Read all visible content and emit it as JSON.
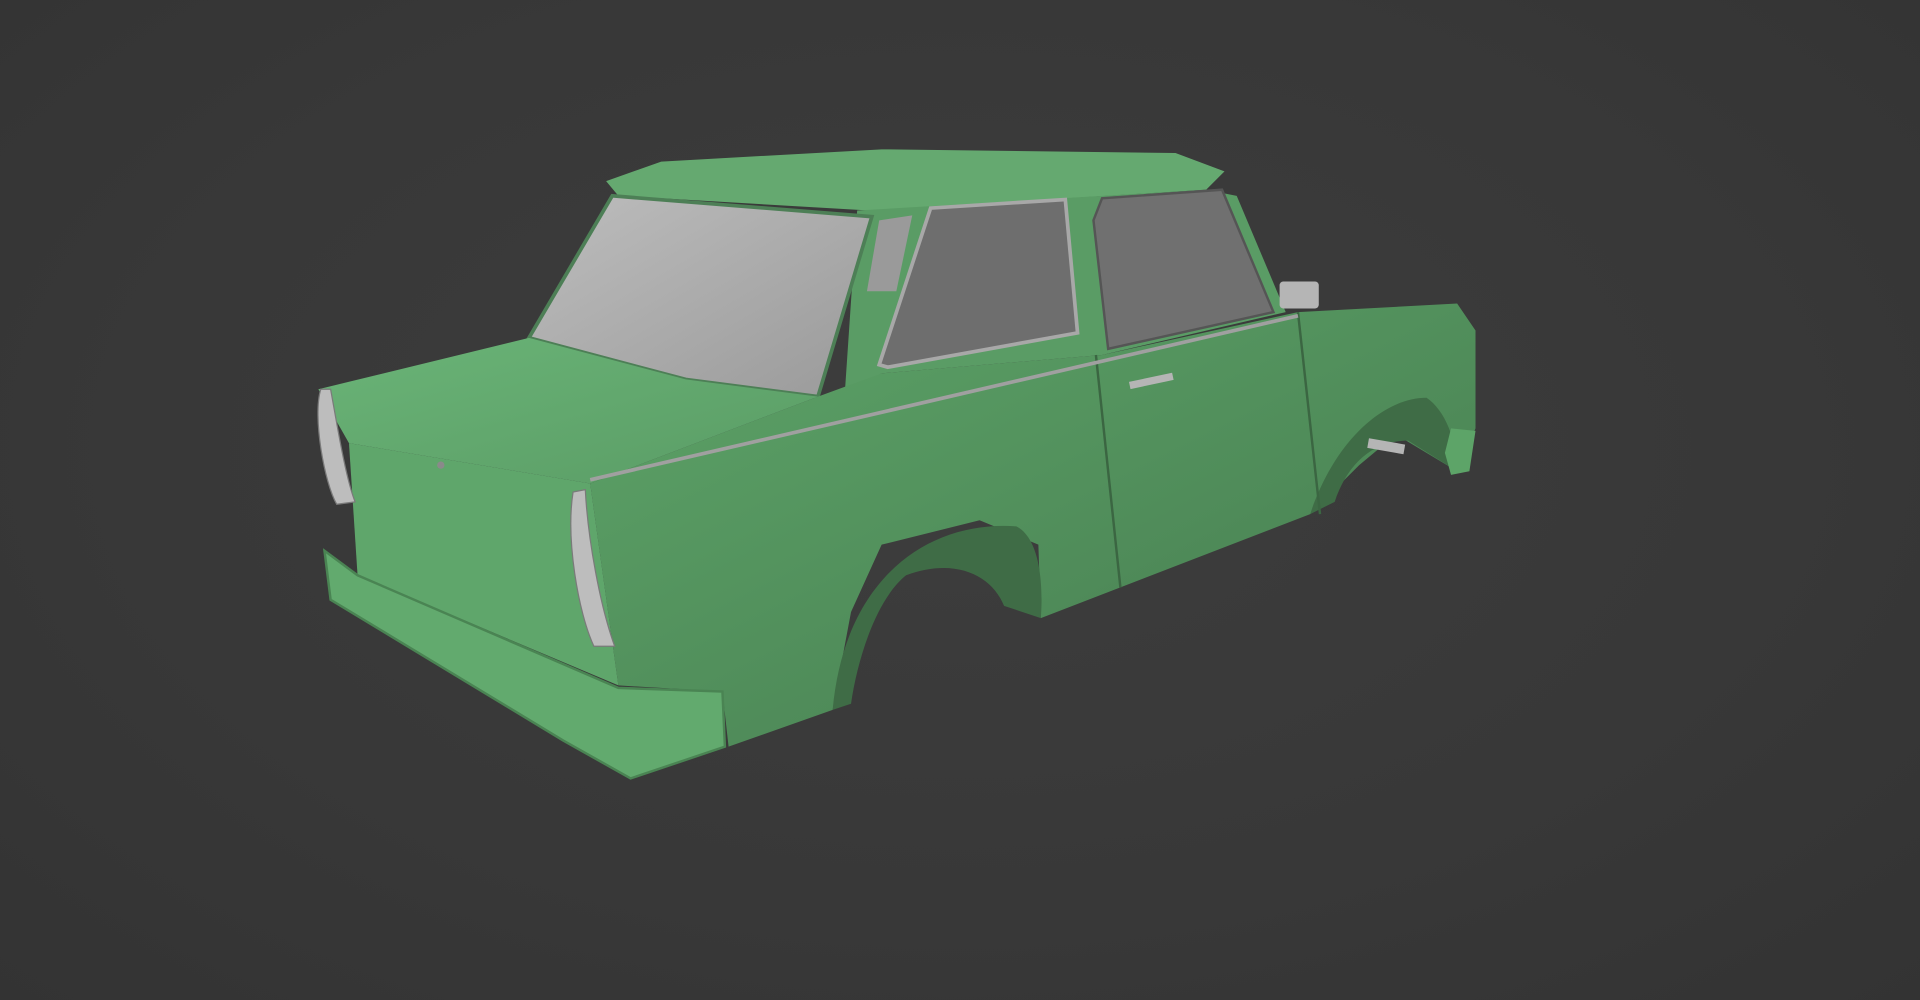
{
  "scene": {
    "background_color": "#393939",
    "subject": "car-body-3d-model",
    "colors": {
      "body": "#5f9e6a",
      "body_light": "#6db57a",
      "body_dark": "#46784f",
      "glass_rear": "#a6a6a6",
      "glass_side": "#6e6e6e",
      "trim": "#b0b0b0"
    }
  }
}
